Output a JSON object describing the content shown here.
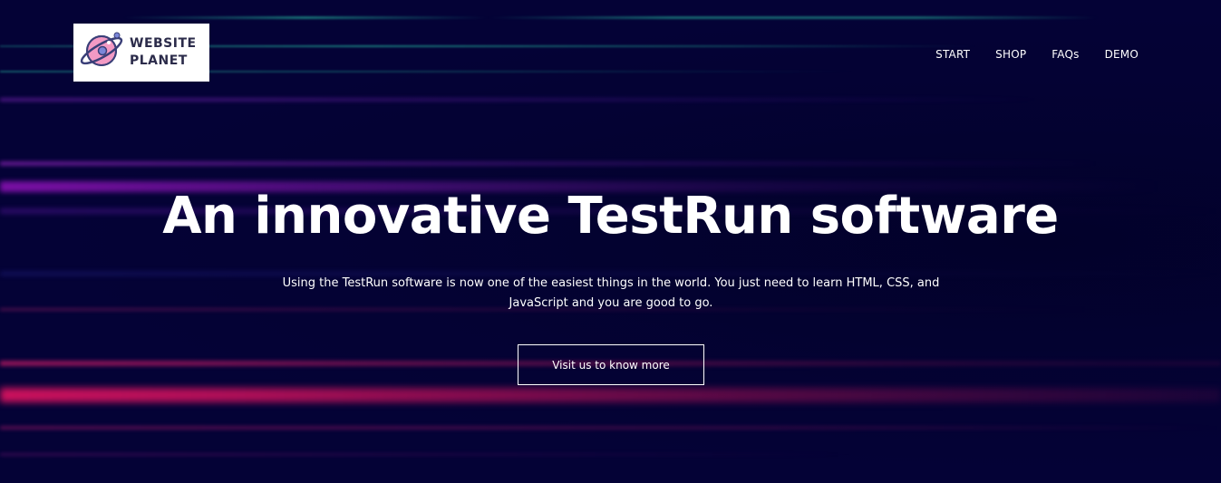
{
  "brand": {
    "logo_line1": "WEBSITE",
    "logo_line2": "PLANET",
    "logo_icon": "planet-icon"
  },
  "nav": {
    "items": [
      {
        "label": "START"
      },
      {
        "label": "SHOP"
      },
      {
        "label": "FAQs"
      },
      {
        "label": "DEMO"
      }
    ]
  },
  "hero": {
    "title": "An innovative TestRun software",
    "description": "Using the TestRun software is now one of the easiest things in the world. You just need to learn HTML, CSS, and JavaScript and you are good to go.",
    "cta_label": "Visit us to know more"
  },
  "colors": {
    "background": "#040236",
    "text": "#ffffff",
    "streak_teal": "#28c8aa",
    "streak_purple": "#a014c8",
    "streak_pink": "#f01464"
  }
}
